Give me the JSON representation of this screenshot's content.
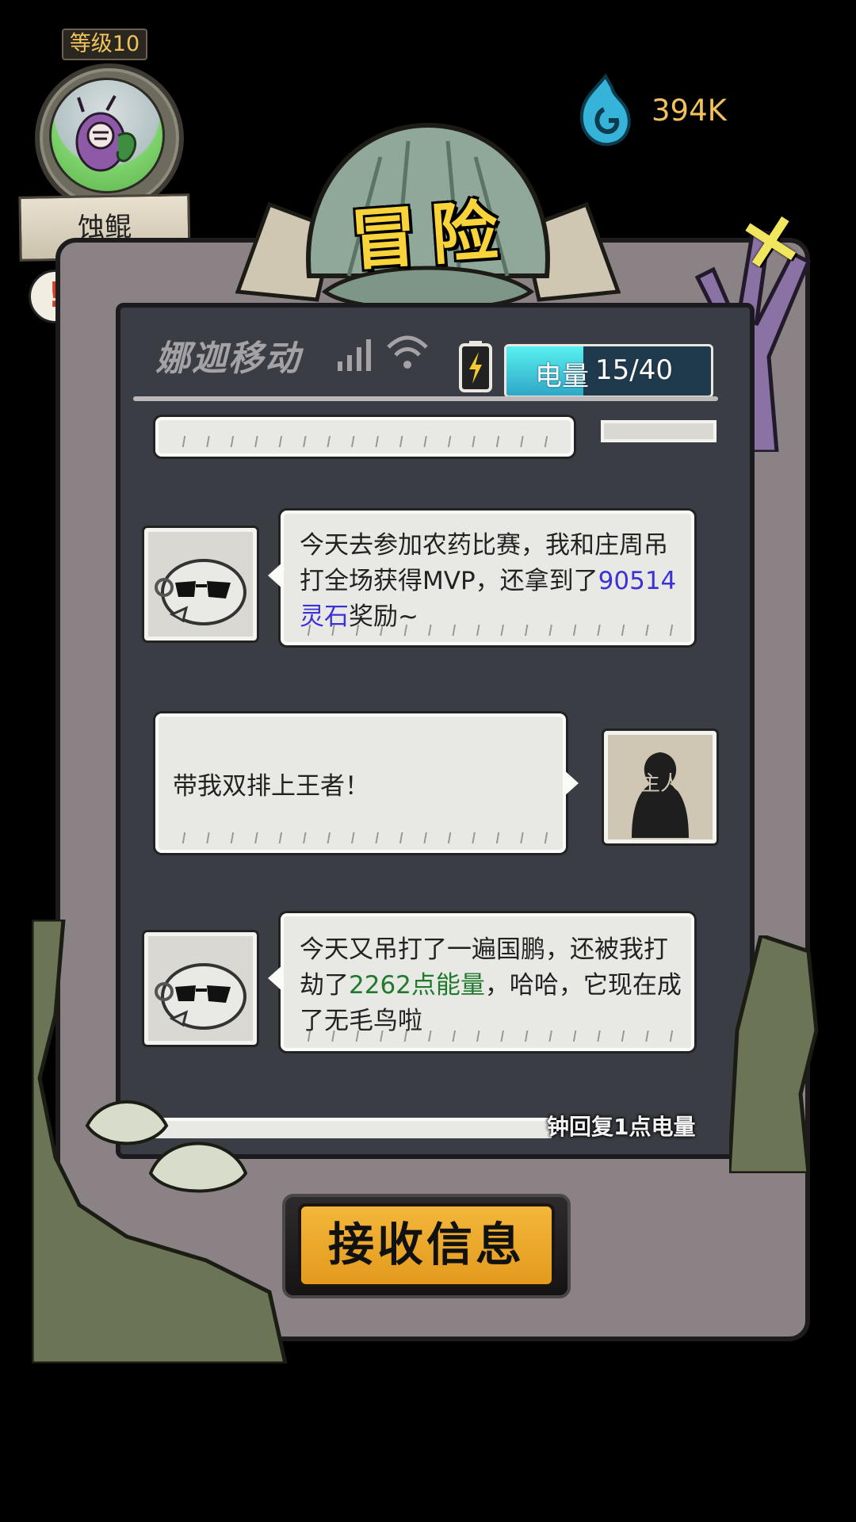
{
  "player": {
    "level_label": "等级10",
    "name": "蚀鲲"
  },
  "currency": {
    "icon": "spirit-flame-icon",
    "value": "394K"
  },
  "title": "冒险",
  "phone": {
    "carrier": "娜迦移动",
    "energy_label": "电量",
    "energy_value": "15/40",
    "energy_fraction": 0.375
  },
  "messages": [
    {
      "sender": "npc",
      "text_before": "今天去参加农药比赛，我和庄周吊打全场获得MVP，还拿到了",
      "highlight": "90514灵石",
      "text_after": "奖励~"
    },
    {
      "sender": "player",
      "avatar_text": "主人",
      "text": "带我双排上王者！"
    },
    {
      "sender": "npc",
      "text_before": "今天又吊打了一遍国鹏，还被我打劫了",
      "highlight": "2262点能量",
      "text_after": "，哈哈，它现在成了无毛鸟啦"
    }
  ],
  "recovery_note": "钟回复1点电量",
  "receive_button_label": "接收信息",
  "colors": {
    "accent_gold": "#f8d33a",
    "currency_text": "#f1c25b",
    "link_blue": "#3b32d6",
    "highlight_green": "#1f7a2e",
    "energy_fill": "#58f0f0"
  }
}
